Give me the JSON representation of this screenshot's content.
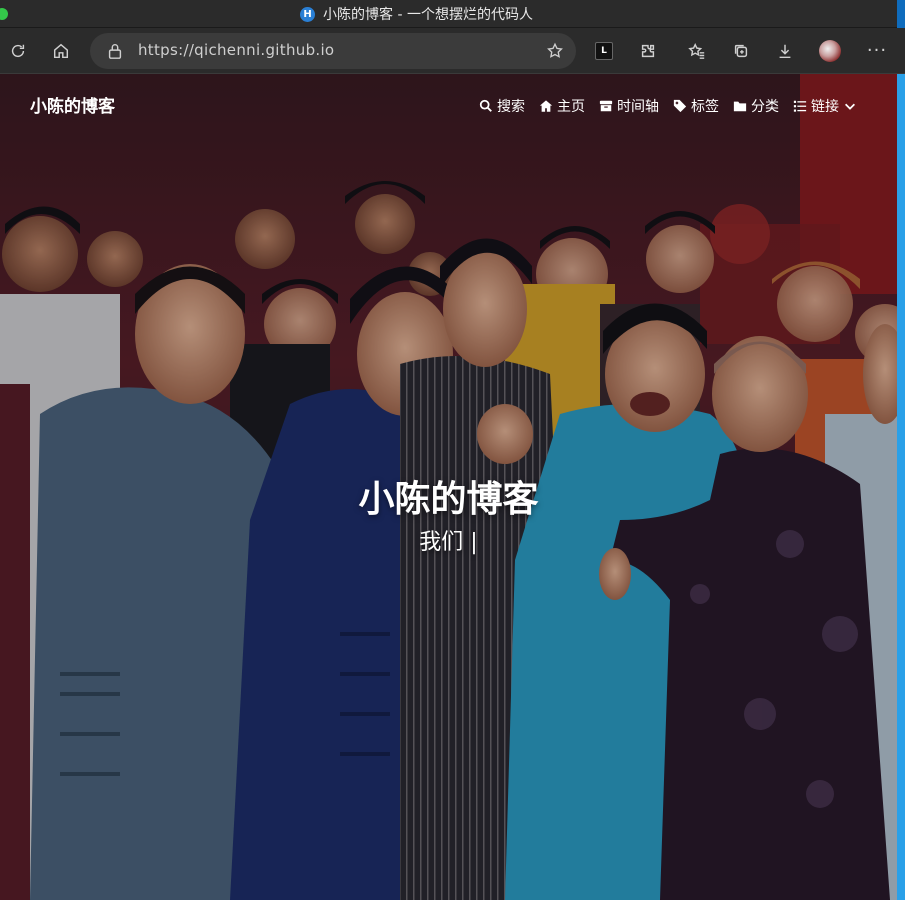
{
  "browser": {
    "tab_title": "小陈的博客 - 一个想摆烂的代码人",
    "favicon_letter": "H",
    "url": "https://qichenni.github.io"
  },
  "site": {
    "brand": "小陈的博客",
    "nav": [
      {
        "label": "搜索",
        "icon": "search-icon"
      },
      {
        "label": "主页",
        "icon": "home-icon"
      },
      {
        "label": "时间轴",
        "icon": "archive-icon"
      },
      {
        "label": "标签",
        "icon": "tag-icon"
      },
      {
        "label": "分类",
        "icon": "folder-icon"
      },
      {
        "label": "链接",
        "icon": "list-icon"
      }
    ]
  },
  "hero": {
    "title": "小陈的博客",
    "subtitle": "我们 |"
  },
  "colors": {
    "accent": "#2aa0e8",
    "chrome": "#2b2b2b"
  }
}
